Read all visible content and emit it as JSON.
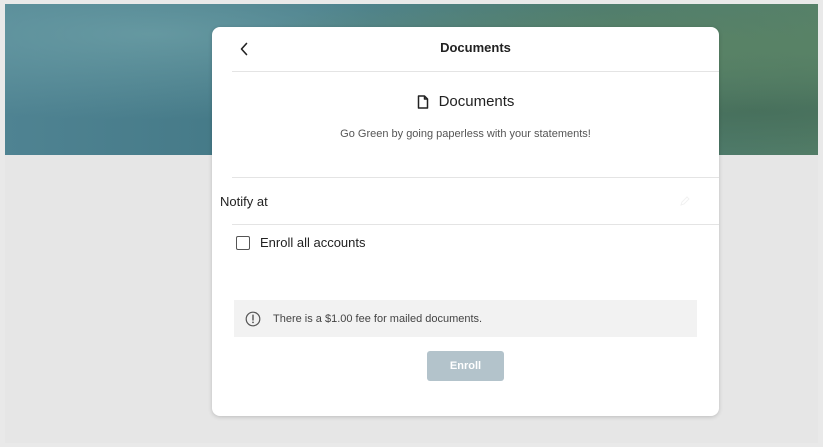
{
  "header": {
    "title": "Documents",
    "back_icon": "chevron-left-icon"
  },
  "section": {
    "icon": "document-icon",
    "title": "Documents",
    "subtitle": "Go Green by going paperless with your statements!"
  },
  "notify": {
    "label": "Notify at"
  },
  "enroll_all": {
    "label": "Enroll all accounts",
    "checked": false
  },
  "notice": {
    "icon": "info-circle-icon",
    "text": "There is a $1.00 fee for mailed documents."
  },
  "actions": {
    "enroll_label": "Enroll",
    "enroll_disabled": true
  },
  "colors": {
    "enroll_button": "#b3c3cb",
    "notice_background": "#f2f2f2",
    "page_background": "#e6e6e6"
  }
}
